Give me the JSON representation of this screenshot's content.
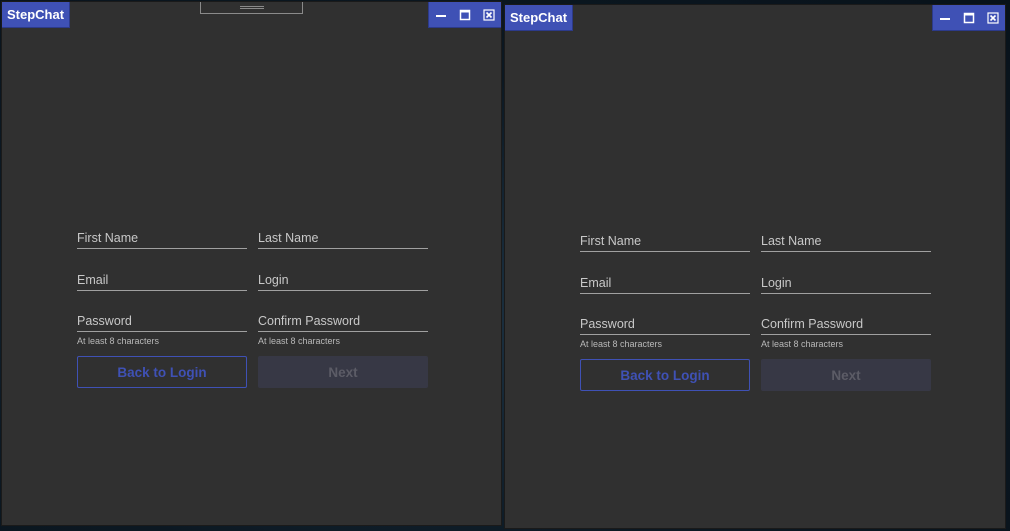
{
  "windows": [
    {
      "app_title": "StepChat",
      "form": {
        "first_name_label": "First Name",
        "last_name_label": "Last Name",
        "email_label": "Email",
        "login_label": "Login",
        "password_label": "Password",
        "confirm_password_label": "Confirm Password",
        "password_hint": "At least 8 characters",
        "confirm_password_hint": "At least 8 characters",
        "back_button": "Back to Login",
        "next_button": "Next"
      }
    },
    {
      "app_title": "StepChat",
      "form": {
        "first_name_label": "First Name",
        "last_name_label": "Last Name",
        "email_label": "Email",
        "login_label": "Login",
        "password_label": "Password",
        "confirm_password_label": "Confirm Password",
        "password_hint": "At least 8 characters",
        "confirm_password_hint": "At least 8 characters",
        "back_button": "Back to Login",
        "next_button": "Next"
      }
    }
  ],
  "icons": {
    "minimize": "minimize-icon",
    "maximize": "maximize-icon",
    "close": "close-icon",
    "drag_handle": "drag-handle-icon"
  },
  "colors": {
    "accent": "#3f51b5",
    "window_bg": "#303030",
    "disabled_button_bg": "#373845",
    "disabled_button_text": "#5c5c66",
    "label_text": "#c8c8c8",
    "underline": "#a0a0a0"
  }
}
